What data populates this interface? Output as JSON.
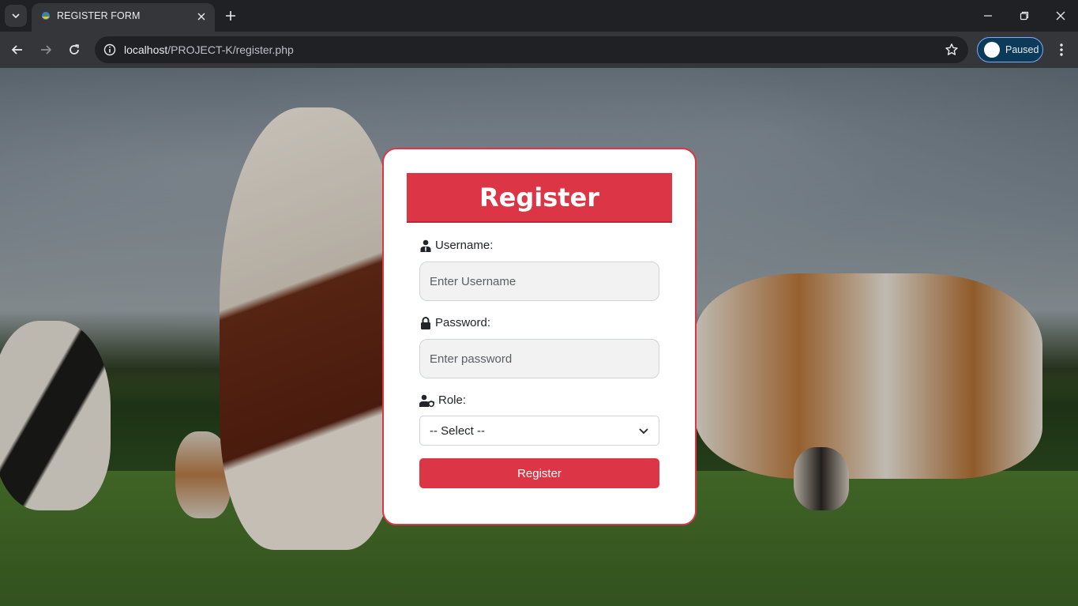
{
  "browser": {
    "tab_title": "REGISTER FORM",
    "url_host": "localhost",
    "url_path": "/PROJECT-K/register.php",
    "profile_label": "Paused"
  },
  "form": {
    "title": "Register",
    "username_label": "Username:",
    "username_placeholder": "Enter Username",
    "password_label": "Password:",
    "password_placeholder": "Enter password",
    "role_label": "Role:",
    "role_selected": "-- Select --",
    "submit_label": "Register"
  },
  "colors": {
    "accent": "#dc3545",
    "chrome_dark": "#202124",
    "chrome_toolbar": "#35363a"
  }
}
